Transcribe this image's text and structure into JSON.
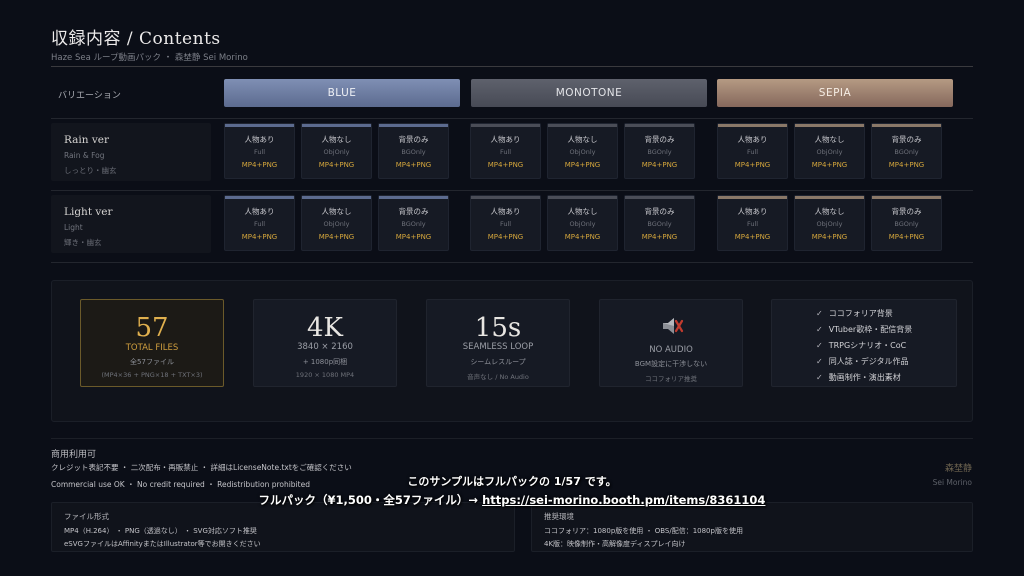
{
  "header": {
    "title": "収録内容 / Contents",
    "subtitle": "Haze Sea ループ動画パック ・ 森埜静 Sei Morino"
  },
  "variations": {
    "label": "バリエーション",
    "blue": "BLUE",
    "monotone": "MONOTONE",
    "sepia": "SEPIA"
  },
  "rows": [
    {
      "name": "Rain ver",
      "sub": "Rain & Fog",
      "mood": "しっとり・幽玄",
      "cells": [
        {
          "jp": "人物あり",
          "en": "Full",
          "fmt": "MP4+PNG"
        },
        {
          "jp": "人物なし",
          "en": "ObjOnly",
          "fmt": "MP4+PNG"
        },
        {
          "jp": "背景のみ",
          "en": "BGOnly",
          "fmt": "MP4+PNG"
        }
      ]
    },
    {
      "name": "Light ver",
      "sub": "Light",
      "mood": "輝き・幽玄",
      "cells": [
        {
          "jp": "人物あり",
          "en": "Full",
          "fmt": "MP4+PNG"
        },
        {
          "jp": "人物なし",
          "en": "ObjOnly",
          "fmt": "MP4+PNG"
        },
        {
          "jp": "背景のみ",
          "en": "BGOnly",
          "fmt": "MP4+PNG"
        }
      ]
    }
  ],
  "stats": {
    "files": {
      "big": "57",
      "en": "TOTAL FILES",
      "jp": "全57ファイル",
      "note": "(MP4×36 + PNG×18 + TXT×3)"
    },
    "res": {
      "big": "4K",
      "en": "3840 × 2160",
      "jp": "+ 1080p同梱",
      "note": "1920 × 1080 MP4"
    },
    "loop": {
      "big": "15s",
      "en": "SEAMLESS LOOP",
      "jp": "シームレスループ",
      "note": "音声なし / No Audio"
    },
    "audio": {
      "icon": "muted-speaker-icon",
      "en": "NO AUDIO",
      "jp": "BGM設定に干渉しない",
      "note": "ココフォリア推奨"
    }
  },
  "uses": [
    "ココフォリア背景",
    "VTuber歌枠・配信背景",
    "TRPGシナリオ・CoC",
    "同人誌・デジタル作品",
    "動画制作・演出素材"
  ],
  "license": {
    "heading": "商用利用可",
    "jp": "クレジット表記不要 ・ 二次配布・再販禁止 ・ 詳細はLicenseNote.txtをご確認ください",
    "en": "Commercial use OK ・ No credit required ・ Redistribution prohibited",
    "sig_jp": "森埜静",
    "sig_en": "Sei Morino"
  },
  "overlay": {
    "line1": "このサンプルはフルパックの 1/57 です。",
    "line2_prefix": "フルパック（¥1,500・全57ファイル）→ ",
    "link": "https://sei-morino.booth.pm/items/8361104"
  },
  "file_format": {
    "heading": "ファイル形式",
    "l1": "MP4（H.264） ・ PNG（透過なし） ・ SVG対応ソフト推奨",
    "l2": "eSVGファイルはAffinityまたはIllustrator等でお開きください"
  },
  "env": {
    "heading": "推奨環境",
    "l1": "ココフォリア：1080p版を使用 ・ OBS/配信：1080p版を使用",
    "l2": "4K版：映像制作・高解像度ディスプレイ向け"
  },
  "colors": {
    "accent_gold": "#d3a53c",
    "blue": "#6d7da2",
    "monotone": "#52555f",
    "sepia": "#9d806f"
  }
}
